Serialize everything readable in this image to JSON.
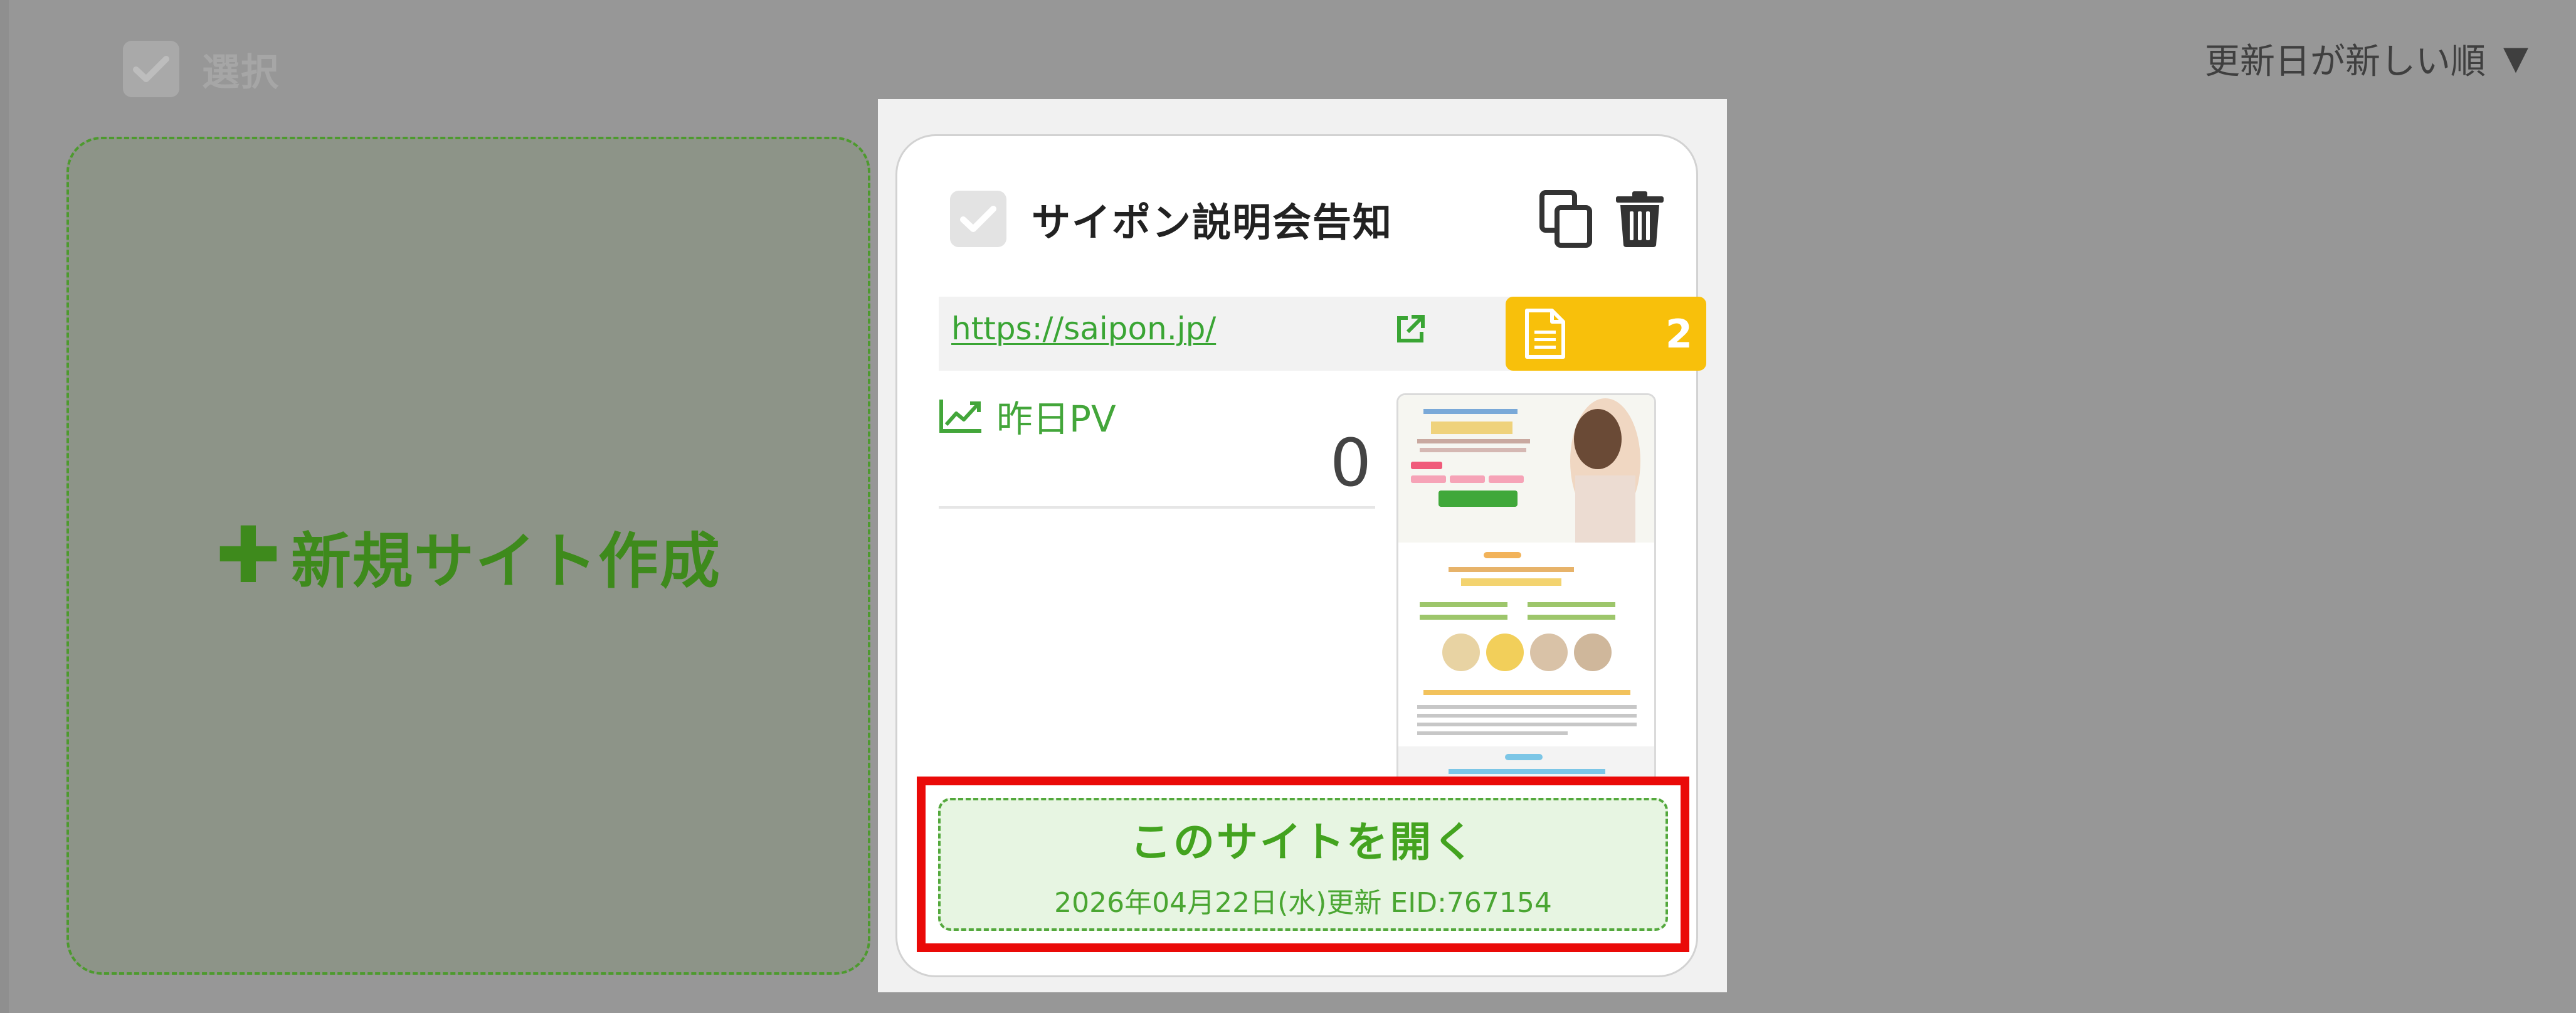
{
  "toolbar": {
    "select_label": "選択",
    "sort_label": "更新日が新しい順",
    "sort_caret": "▼"
  },
  "new_site": {
    "plus": "✚",
    "label": "新規サイト作成"
  },
  "card": {
    "title": "サイポン説明会告知",
    "url": "https://saipon.jp/",
    "page_count": "2",
    "pv_label": "昨日PV",
    "pv_value": "0",
    "open_label": "このサイトを開く",
    "updated": "2026年04月22日(水)更新 EID:767154"
  },
  "icons": {
    "checkbox": "check-icon",
    "copy": "copy-icon",
    "delete": "trash-icon",
    "external": "external-link-icon",
    "pages": "document-icon",
    "pv": "line-chart-icon"
  },
  "colors": {
    "accent_green": "#43a31f",
    "badge_yellow": "#f8c00b",
    "highlight_red": "#ea0a08",
    "overlay_gray": "#979797"
  }
}
